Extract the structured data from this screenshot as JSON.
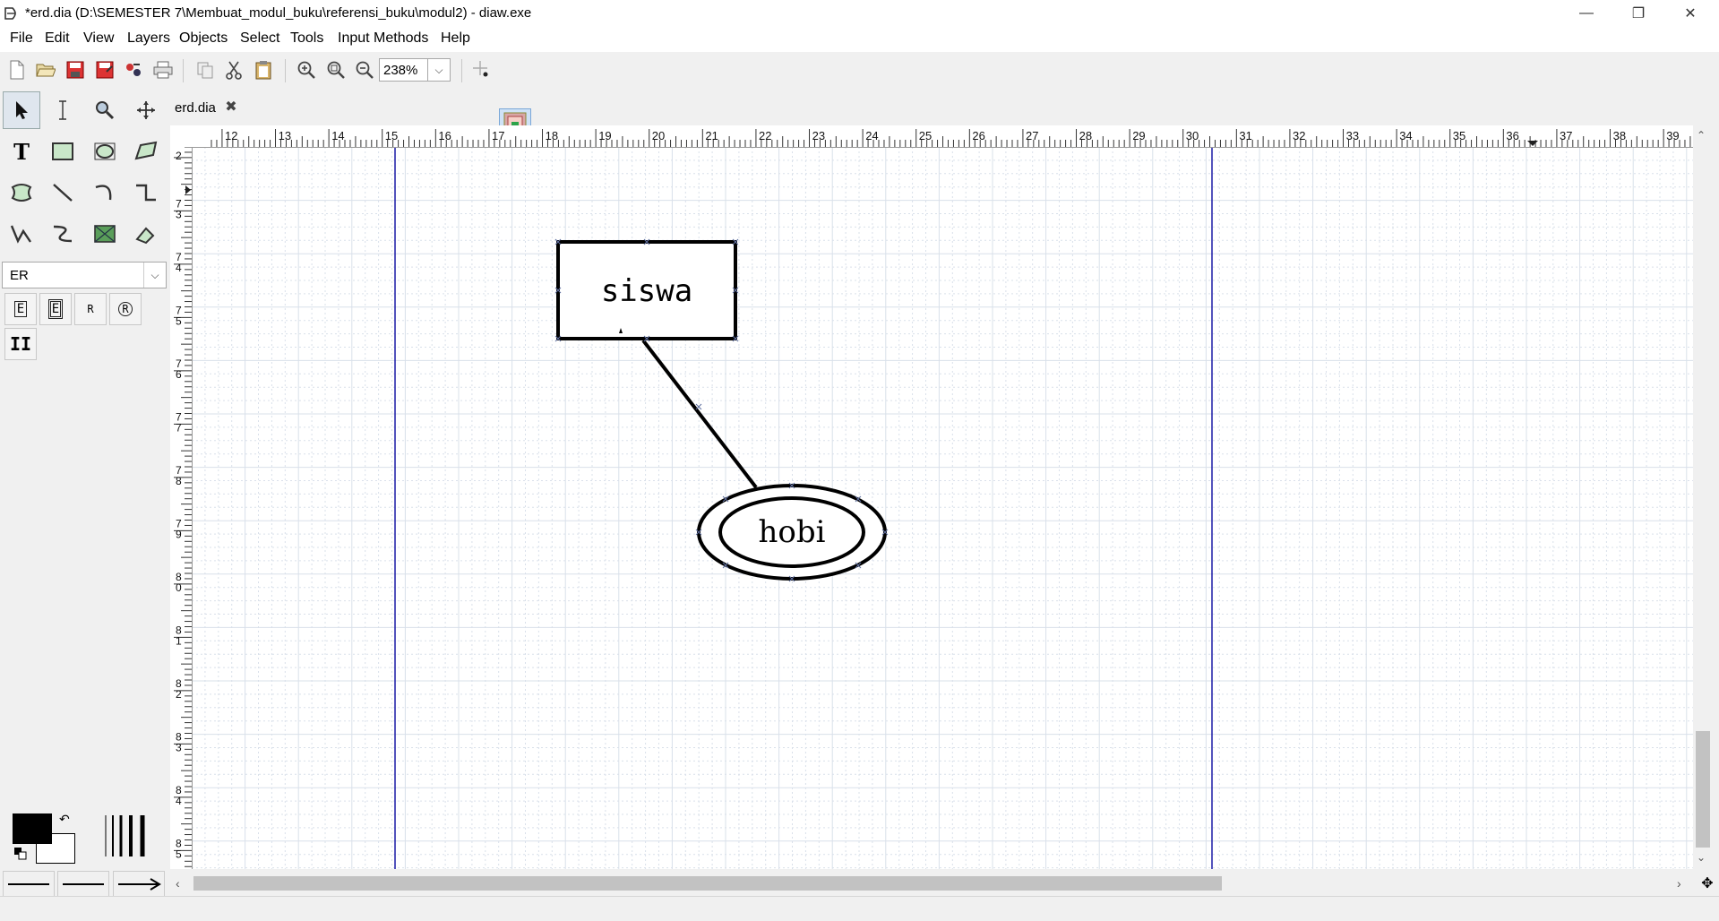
{
  "window": {
    "title": "*erd.dia (D:\\SEMESTER 7\\Membuat_modul_buku\\referensi_buku\\modul2) - diaw.exe",
    "minimize_glyph": "—",
    "maximize_glyph": "❐",
    "close_glyph": "✕"
  },
  "menu": [
    "File",
    "Edit",
    "View",
    "Layers",
    "Objects",
    "Select",
    "Tools",
    "Input Methods",
    "Help"
  ],
  "toolbar": {
    "zoom": "238%",
    "icons": [
      "new-file-icon",
      "open-icon",
      "save-icon",
      "save-as-icon",
      "export-icon",
      "print-icon",
      "copy-icon",
      "cut-icon",
      "paste-icon",
      "zoom-in-icon",
      "zoom-fit-icon",
      "zoom-out-icon",
      "snap-to-grid-icon",
      "snap-to-objects-icon"
    ]
  },
  "toolbox": {
    "tools": [
      "pointer",
      "text-edit",
      "magnify",
      "scroll",
      "text",
      "box",
      "ellipse",
      "polygon",
      "beziergon",
      "line",
      "arc",
      "zigzagline",
      "polyline",
      "bezierline",
      "image",
      "outline"
    ],
    "sheet": "ER",
    "sheet_tools": [
      "E",
      "E",
      "R",
      "R",
      "II"
    ]
  },
  "tab": {
    "label": "erd.dia",
    "close_glyph": "✖"
  },
  "ruler": {
    "h_labels": [
      "12",
      "13",
      "14",
      "15",
      "16",
      "17",
      "18",
      "19",
      "20",
      "21",
      "22",
      "23",
      "24",
      "25",
      "26",
      "27",
      "28",
      "29",
      "30",
      "31",
      "32",
      "33",
      "34",
      "35",
      "36",
      "37",
      "38",
      "39"
    ],
    "v_labels": [
      "2",
      "7 3",
      "7 4",
      "7 5",
      "7 6",
      "7 7",
      "7 8",
      "7 9",
      "8 0",
      "8 1",
      "8 2",
      "8 3",
      "8 4",
      "8 5"
    ]
  },
  "diagram": {
    "entity": {
      "label": "siswa"
    },
    "attribute": {
      "label": "hobi",
      "multivalued": true
    },
    "line_color": "#000000",
    "page_break_color": "#1a1aa6",
    "grid_color": "#d9e0ea"
  },
  "colors": {
    "foreground": "#000000",
    "background": "#ffffff"
  }
}
